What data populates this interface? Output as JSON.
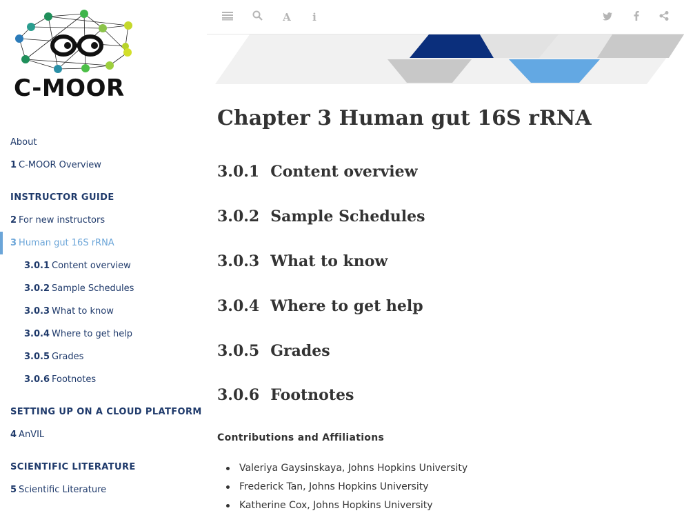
{
  "logo": {
    "text": "C-MOOR"
  },
  "topbar": {
    "buttons": [
      {
        "name": "toggle-sidebar",
        "glyph": "≡"
      },
      {
        "name": "search",
        "glyph": "⌕"
      },
      {
        "name": "font-settings",
        "glyph": "A"
      },
      {
        "name": "info",
        "glyph": "i"
      }
    ],
    "share": [
      {
        "name": "twitter",
        "glyph": "t"
      },
      {
        "name": "facebook",
        "glyph": "f"
      },
      {
        "name": "share",
        "glyph": "⋖"
      }
    ]
  },
  "toc": {
    "about": "About",
    "ch1": {
      "num": "1",
      "label": "C-MOOR Overview"
    },
    "part_instructor": "INSTRUCTOR GUIDE",
    "ch2": {
      "num": "2",
      "label": "For new instructors"
    },
    "ch3": {
      "num": "3",
      "label": "Human gut 16S rRNA"
    },
    "subs": [
      {
        "num": "3.0.1",
        "label": "Content overview"
      },
      {
        "num": "3.0.2",
        "label": "Sample Schedules"
      },
      {
        "num": "3.0.3",
        "label": "What to know"
      },
      {
        "num": "3.0.4",
        "label": "Where to get help"
      },
      {
        "num": "3.0.5",
        "label": "Grades"
      },
      {
        "num": "3.0.6",
        "label": "Footnotes"
      }
    ],
    "part_cloud": "SETTING UP ON A CLOUD PLATFORM",
    "ch4": {
      "num": "4",
      "label": "AnVIL"
    },
    "part_lit": "SCIENTIFIC LITERATURE",
    "ch5": {
      "num": "5",
      "label": "Scientific Literature"
    }
  },
  "main": {
    "chapter_title": "Chapter 3   Human gut 16S rRNA",
    "sections": [
      {
        "num": "3.0.1",
        "title": "Content overview"
      },
      {
        "num": "3.0.2",
        "title": "Sample Schedules"
      },
      {
        "num": "3.0.3",
        "title": "What to know"
      },
      {
        "num": "3.0.4",
        "title": "Where to get help"
      },
      {
        "num": "3.0.5",
        "title": "Grades"
      },
      {
        "num": "3.0.6",
        "title": "Footnotes"
      }
    ],
    "contrib_heading": "Contributions and Affiliations",
    "people": [
      "Valeriya Gaysinskaya, Johns Hopkins University",
      "Frederick Tan, Johns Hopkins University",
      "Katherine Cox, Johns Hopkins University"
    ]
  },
  "colors": {
    "nav_text": "#1f3a6b",
    "active": "#6ba5d8",
    "banner_navy": "#0b2f7c",
    "banner_blue": "#63a8e3",
    "banner_gray": "#c9c9c9"
  }
}
